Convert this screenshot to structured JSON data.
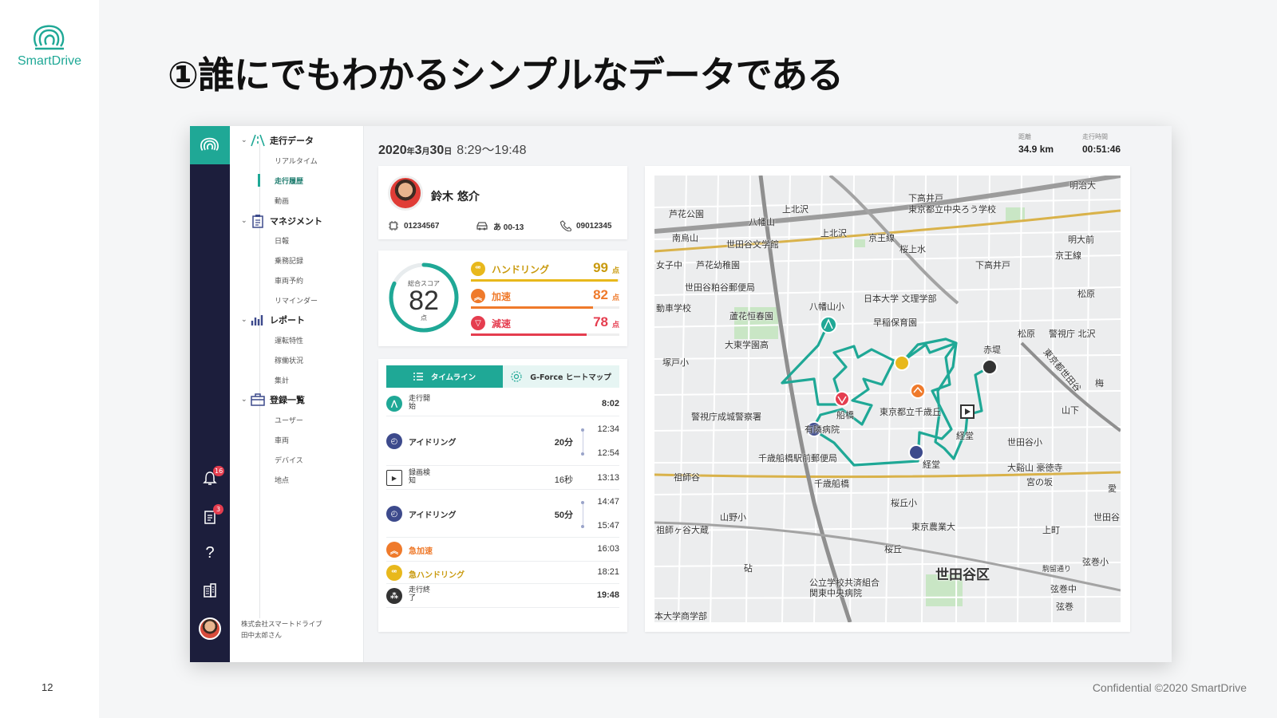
{
  "slide": {
    "logo_text": "SmartDrive",
    "title": "①誰にでもわかるシンプルなデータである",
    "page_number": "12",
    "footer": "Confidential  ©2020 SmartDrive"
  },
  "rail": {
    "notifications_badge": "16",
    "reports_badge": "3",
    "help_glyph": "?"
  },
  "sidenav": {
    "sections": [
      {
        "label": "走行データ",
        "items": [
          "リアルタイム",
          "走行履歴",
          "動画"
        ]
      },
      {
        "label": "マネジメント",
        "items": [
          "日報",
          "乗務記録",
          "車両予約",
          "リマインダー"
        ]
      },
      {
        "label": "レポート",
        "items": [
          "運転特性",
          "稼働状況",
          "集計"
        ]
      },
      {
        "label": "登録一覧",
        "items": [
          "ユーザー",
          "車両",
          "デバイス",
          "地点"
        ]
      }
    ],
    "active_item": "走行履歴",
    "footer_company": "株式会社スマートドライブ",
    "footer_user": "田中太郎さん"
  },
  "header": {
    "date_year": "2020",
    "date_year_unit": "年",
    "date_month": "3",
    "date_month_unit": "月",
    "date_day": "30",
    "date_day_unit": "日",
    "time_range": "8:29〜19:48",
    "distance_label": "距離",
    "distance_value": "34.9 km",
    "duration_label": "走行時間",
    "duration_value": "00:51:46"
  },
  "driver": {
    "name": "鈴木 悠介",
    "device_id": "01234567",
    "plate": "あ 00-13",
    "phone": "09012345"
  },
  "score": {
    "label": "総合スコア",
    "value": "82",
    "unit": "点",
    "fraction": 0.82,
    "subs": [
      {
        "label": "ハンドリング",
        "value": "99",
        "unit": "点",
        "fraction": 0.99,
        "color": "#e8b81c"
      },
      {
        "label": "加速",
        "value": "82",
        "unit": "点",
        "fraction": 0.82,
        "color": "#ef7a2b"
      },
      {
        "label": "減速",
        "value": "78",
        "unit": "点",
        "fraction": 0.78,
        "color": "#e53d4f"
      }
    ]
  },
  "timeline": {
    "tab_timeline": "タイムライン",
    "tab_gforce": "G-Force ヒートマップ",
    "events": [
      {
        "label": "走行開始",
        "duration": "",
        "time": "8:02"
      },
      {
        "label": "アイドリング",
        "duration": "20分",
        "start": "12:34",
        "end": "12:54"
      },
      {
        "label": "録画検知",
        "duration": "16秒",
        "time": "13:13"
      },
      {
        "label": "アイドリング",
        "duration": "50分",
        "start": "14:47",
        "end": "15:47"
      },
      {
        "label": "急加速",
        "duration": "",
        "time": "16:03"
      },
      {
        "label": "急ハンドリング",
        "duration": "",
        "time": "18:21"
      },
      {
        "label": "走行終了",
        "duration": "",
        "time": "19:48"
      }
    ]
  },
  "map": {
    "labels": [
      "明治大",
      "下高井戸",
      "東京都立中央ろう学校",
      "芦花公園",
      "八幡山",
      "上北沢",
      "南烏山",
      "世田谷文学館",
      "上北沢",
      "京王線",
      "桜上水",
      "明大前",
      "京王線",
      "下高井戸",
      "女子中",
      "芦花幼稚園",
      "世田谷粕谷郵便局",
      "日本大学 文理学部",
      "松原",
      "八幡山小",
      "動車学校",
      "蘆花恒春園",
      "早稲保育園",
      "大東学園高",
      "松原",
      "警視庁 北沢",
      "赤堤",
      "塚戸小",
      "東京都世田谷",
      "梅",
      "船橋",
      "東京都立千歳丘",
      "山下",
      "警視庁成城警察署",
      "有隣病院",
      "経堂",
      "世田谷小",
      "千歳船橋駅前郵便局",
      "経堂",
      "大谿山 豪徳寺",
      "宮の坂",
      "祖師谷",
      "千歳船橋",
      "桜丘小",
      "山野小",
      "東京農業大",
      "祖師ヶ谷大蔵",
      "桜丘",
      "上町",
      "世田谷区",
      "弦巻小",
      "弦巻中",
      "公立学校共済組合 関東中央病院",
      "弦巻",
      "本大学商学部",
      "砧",
      "世田谷",
      "駒留通り",
      "愛"
    ],
    "route_color": "#1fa896"
  }
}
